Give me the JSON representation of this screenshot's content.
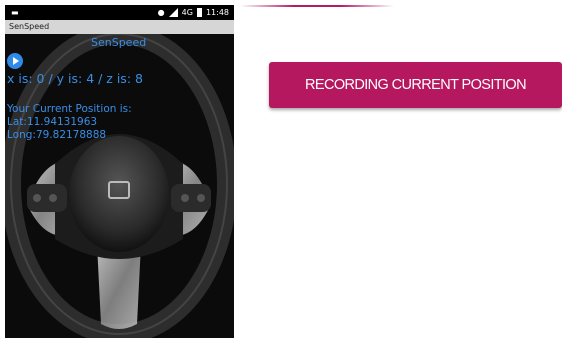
{
  "status_bar": {
    "time": "11:48",
    "network": "4G"
  },
  "app": {
    "titlebar": "SenSpeed",
    "title": "SenSpeed",
    "axes": "x is: 0 / y is: 4 / z is: 8",
    "position_label": "Your Current Position is:",
    "lat": "Lat:11.94131963",
    "long": "Long:79.82178888"
  },
  "record_button": {
    "label": "RECORDING CURRENT POSITION"
  },
  "colors": {
    "accent": "#b5185f",
    "app_text": "#3a8ee6"
  },
  "icons": [
    "notification-icon",
    "location-icon",
    "signal-icon",
    "battery-icon",
    "play-icon"
  ]
}
